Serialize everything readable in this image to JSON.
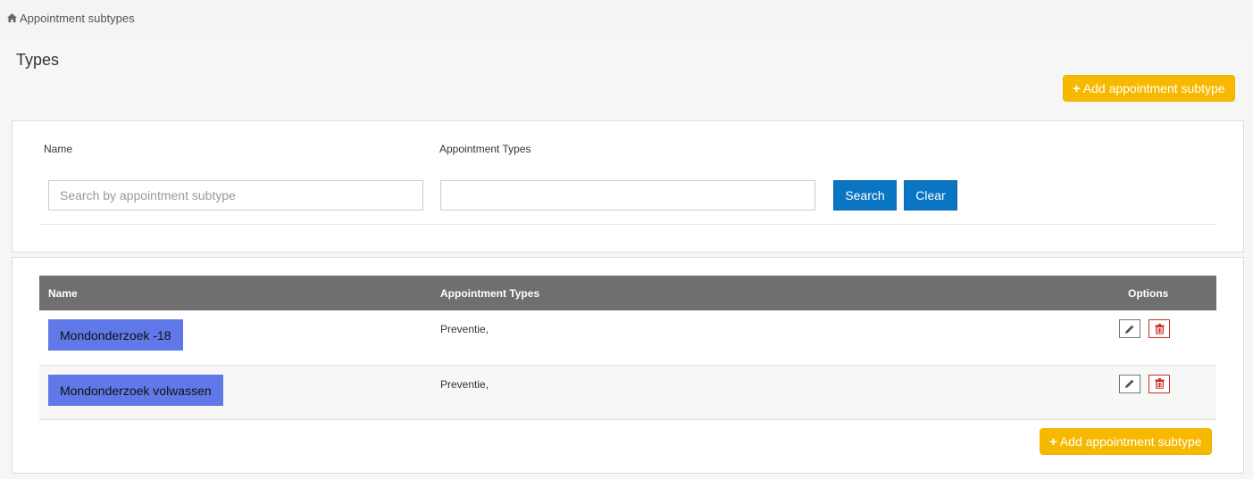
{
  "breadcrumb": {
    "home_icon": "home-icon",
    "label": "Appointment subtypes"
  },
  "page": {
    "title": "Types",
    "add_button_label": "Add appointment subtype"
  },
  "filter": {
    "name_label": "Name",
    "name_placeholder": "Search by appointment subtype",
    "name_value": "",
    "types_label": "Appointment Types",
    "types_value": "",
    "search_label": "Search",
    "clear_label": "Clear"
  },
  "table": {
    "headers": {
      "name": "Name",
      "types": "Appointment Types",
      "options": "Options"
    },
    "rows": [
      {
        "name": "Mondonderzoek -18",
        "types": "Preventie,"
      },
      {
        "name": "Mondonderzoek volwassen",
        "types": "Preventie,"
      }
    ]
  },
  "colors": {
    "accent_yellow": "#f7b900",
    "primary_blue": "#0a75c2",
    "name_tag": "#6178e8",
    "header_gray": "#6f6f6f",
    "delete_red": "#c9302c"
  }
}
